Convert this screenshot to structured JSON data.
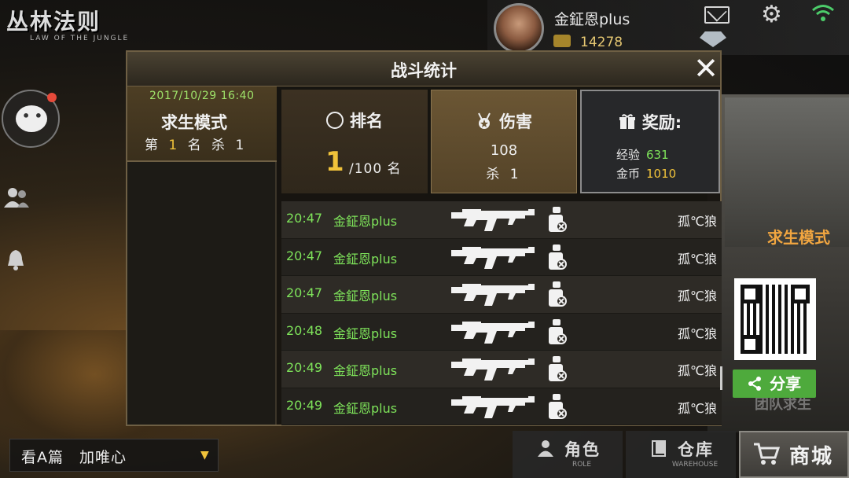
{
  "logo": {
    "main": "丛林法则",
    "sub": "LAW OF THE JUNGLE"
  },
  "profile": {
    "name": "金鉦恩plus",
    "coins": "14278"
  },
  "icons": {
    "mail": "mail-icon",
    "settings": "gear-icon",
    "wifi": "wifi-icon",
    "chat": "chat-bubble-icon",
    "friends": "friends-icon",
    "bell": "bell-icon"
  },
  "colors": {
    "accent_green": "#7ee35a",
    "accent_gold": "#f0c23a",
    "share_green": "#4eaa3c"
  },
  "dialog": {
    "title": "战斗统计",
    "close": "✕",
    "match": {
      "datetime": "2017/10/29 16:40",
      "mode": "求生模式",
      "rank_prefix": "第",
      "rank": "1",
      "rank_mid": "名 杀",
      "kills": "1"
    },
    "stats": {
      "rank_label": "排名",
      "rank_value": "1",
      "rank_suffix": "/100 名",
      "damage_label": "伤害",
      "damage_value": "108",
      "damage_kill_prefix": "杀",
      "damage_kills": "1",
      "reward_label": "奖励:",
      "exp_label": "经验",
      "exp_value": "631",
      "gold_label": "金币",
      "gold_value": "1010"
    },
    "kills": [
      {
        "time": "20:47",
        "killer": "金鉦恩plus",
        "victim": "孤℃狼"
      },
      {
        "time": "20:47",
        "killer": "金鉦恩plus",
        "victim": "孤℃狼"
      },
      {
        "time": "20:47",
        "killer": "金鉦恩plus",
        "victim": "孤℃狼"
      },
      {
        "time": "20:48",
        "killer": "金鉦恩plus",
        "victim": "孤℃狼"
      },
      {
        "time": "20:49",
        "killer": "金鉦恩plus",
        "victim": "孤℃狼"
      },
      {
        "time": "20:49",
        "killer": "金鉦恩plus",
        "victim": "孤℃狼"
      }
    ]
  },
  "right": {
    "mode_banner": "求生模式",
    "share": "分享",
    "team_mode": "团队求生"
  },
  "bottom": {
    "chat_channel": "看A篇　加唯心",
    "role_label": "角色",
    "role_sub": "ROLE",
    "warehouse_label": "仓库",
    "warehouse_sub": "WAREHOUSE",
    "shop_label": "商城"
  }
}
